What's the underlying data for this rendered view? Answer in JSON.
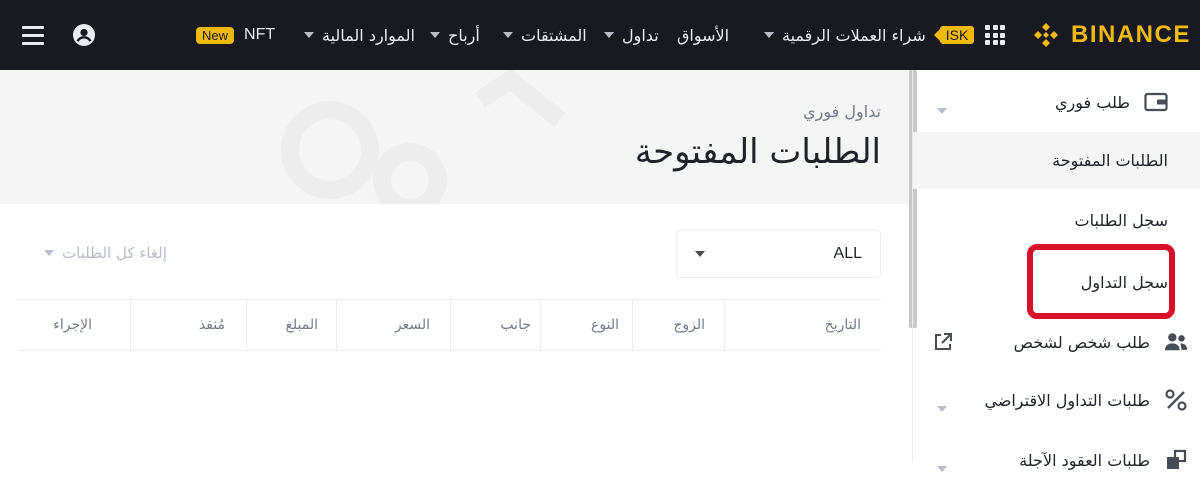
{
  "brand": {
    "name": "BINANCE"
  },
  "topnav": {
    "items": [
      {
        "label": "شراء العملات الرقمية",
        "badge": "ISK"
      },
      {
        "label": "الأسواق"
      },
      {
        "label": "تداول"
      },
      {
        "label": "المشتقات"
      },
      {
        "label": "أرباح"
      },
      {
        "label": "الموارد المالية"
      },
      {
        "label": "NFT",
        "badge": "New"
      }
    ]
  },
  "page": {
    "breadcrumb": "تداول فوري",
    "title": "الطلبات المفتوحة"
  },
  "sidebar": {
    "items": [
      {
        "label": "طلب فوري",
        "icon": "wallet-icon"
      },
      {
        "label": "الطلبات المفتوحة"
      },
      {
        "label": "سجل الطلبات"
      },
      {
        "label": "سجل التداول"
      },
      {
        "label": "طلب شخص لشخص",
        "icon": "users-icon"
      },
      {
        "label": "طلبات التداول الاقتراضي",
        "icon": "percent-icon"
      },
      {
        "label": "طلبات العقود الآجلة",
        "icon": "futures-icon"
      }
    ]
  },
  "filters": {
    "select_value": "ALL",
    "cancel_all": "إلغاء كل الطلبات"
  },
  "table": {
    "columns": [
      "التاريخ",
      "الزوج",
      "النوع",
      "جانب",
      "السعر",
      "المبلغ",
      "مُنفذ",
      "الإجراء"
    ]
  },
  "colors": {
    "accent": "#f0b90b",
    "topbar": "#181a20",
    "highlight": "#d8102a"
  }
}
